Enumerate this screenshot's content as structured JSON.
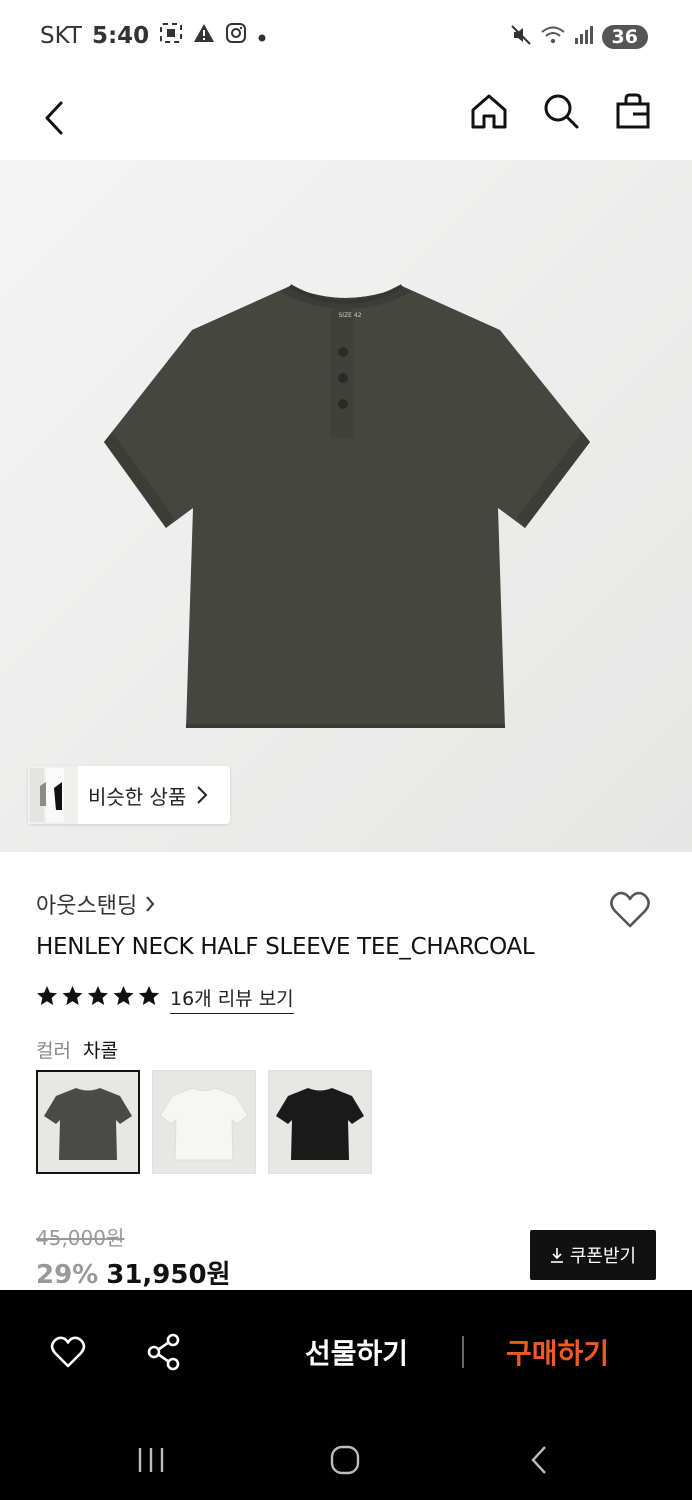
{
  "status": {
    "carrier": "SKT",
    "time": "5:40",
    "battery": "36"
  },
  "product": {
    "brand": "아웃스탠딩",
    "title": "HENLEY NECK HALF SLEEVE TEE_CHARCOAL",
    "rating_stars": 5,
    "review_link": "16개 리뷰 보기",
    "color_key": "컬러",
    "color_value": "차콜",
    "swatches": [
      {
        "color": "#4a4b46",
        "selected": true
      },
      {
        "color": "#f2f2f0",
        "selected": false
      },
      {
        "color": "#1a1a1a",
        "selected": false
      }
    ],
    "original_price": "45,000원",
    "discount": "29%",
    "price": "31,950원",
    "similar_label": "비슷한 상품",
    "tag_text": "SIZE 42"
  },
  "actions": {
    "coupon": "쿠폰받기",
    "gift": "선물하기",
    "buy": "구매하기"
  },
  "colors": {
    "accent": "#f15a22",
    "shirt": "#454640"
  }
}
